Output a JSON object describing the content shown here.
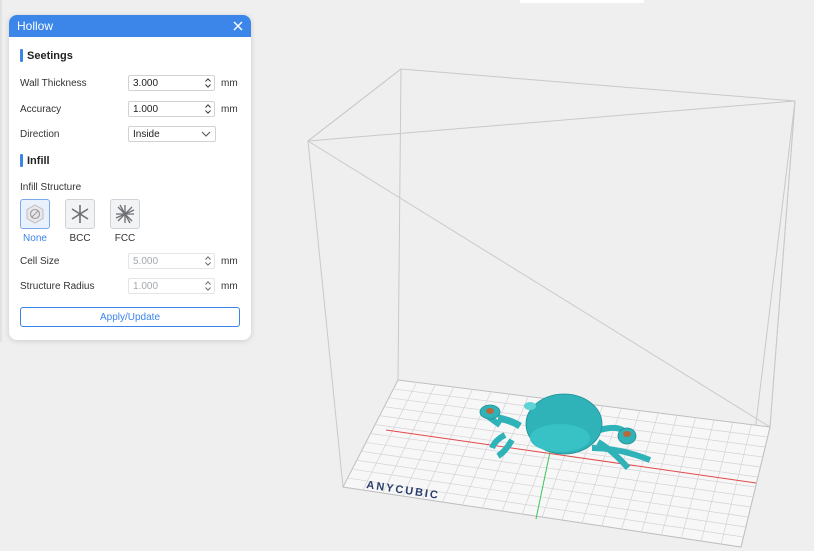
{
  "panel": {
    "title": "Hollow",
    "settings_header": "Seetings",
    "fields": {
      "wall_thickness": {
        "label": "Wall Thickness",
        "value": "3.000",
        "unit": "mm"
      },
      "accuracy": {
        "label": "Accuracy",
        "value": "1.000",
        "unit": "mm"
      },
      "direction": {
        "label": "Direction",
        "value": "Inside"
      }
    },
    "infill_header": "Infill",
    "infill_structure_label": "Infill Structure",
    "infill_options": [
      {
        "label": "None",
        "icon": "none-icon",
        "selected": true
      },
      {
        "label": "BCC",
        "icon": "bcc-icon",
        "selected": false
      },
      {
        "label": "FCC",
        "icon": "fcc-icon",
        "selected": false
      }
    ],
    "cell_size": {
      "label": "Cell Size",
      "value": "5.000",
      "unit": "mm"
    },
    "structure_radius": {
      "label": "Structure Radius",
      "value": "1.000",
      "unit": "mm"
    },
    "apply_label": "Apply/Update"
  },
  "viewport": {
    "brand": "ANYCUBIC",
    "model_color": "#2fb3b8",
    "x_axis_color": "#e24a4a",
    "y_axis_color": "#3cc35a"
  },
  "colors": {
    "accent": "#3b86e8",
    "background": "#efeff0"
  }
}
